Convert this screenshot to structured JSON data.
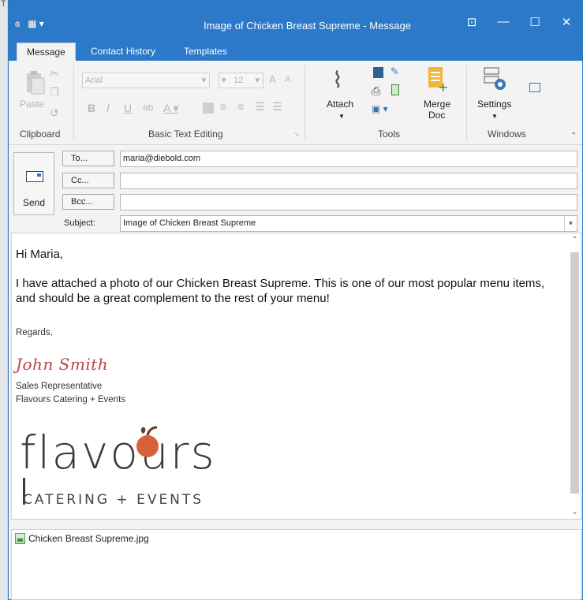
{
  "window": {
    "title": "Image of Chicken Breast Supreme - Message",
    "left_marker": "T",
    "controls": {
      "ribbon_display": "⊡",
      "minimize": "—",
      "maximize": "☐",
      "close": "✕"
    }
  },
  "tabs": [
    {
      "label": "Message",
      "active": true
    },
    {
      "label": "Contact History",
      "active": false
    },
    {
      "label": "Templates",
      "active": false
    }
  ],
  "ribbon": {
    "clipboard": {
      "group": "Clipboard",
      "paste": "Paste"
    },
    "basic_text": {
      "group": "Basic Text Editing",
      "font": "Arial",
      "size": "12"
    },
    "tools": {
      "group": "Tools",
      "attach": "Attach"
    },
    "merge": {
      "label_line1": "Merge",
      "label_line2": "Doc"
    },
    "windows": {
      "group": "Windows",
      "settings": "Settings"
    }
  },
  "header": {
    "send_label": "Send",
    "to_label": "To...",
    "cc_label": "Cc...",
    "bcc_label": "Bcc...",
    "subject_label": "Subject:",
    "to_value": "maria@diebold.com",
    "cc_value": "",
    "bcc_value": "",
    "subject_value": "Image of Chicken Breast Supreme"
  },
  "body": {
    "greeting": "Hi Maria,",
    "paragraph": "I have attached a photo of our Chicken Breast Supreme. This is one of our most popular menu items, and should be a great complement to the rest of your menu!",
    "closing": "Regards,",
    "signature_name": "John Smith",
    "signature_title": "Sales Representative",
    "signature_company": "Flavours Catering + Events",
    "logo_word": "flavours",
    "logo_tagline": "CATERING + EVENTS"
  },
  "attachments": [
    {
      "name": "Chicken Breast Supreme.jpg"
    }
  ],
  "colors": {
    "accent": "#2b79c8",
    "signature": "#b8454a"
  }
}
